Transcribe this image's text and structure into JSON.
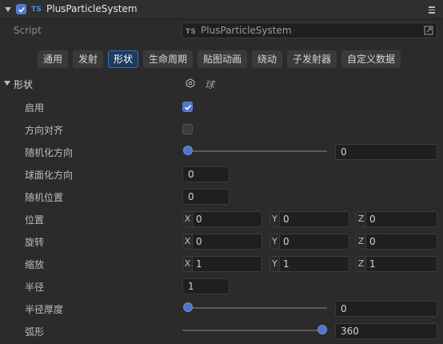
{
  "header": {
    "badge": "TS",
    "title": "PlusParticleSystem",
    "enabled": true,
    "menu_icon": "hamburger-menu-icon"
  },
  "script": {
    "label": "Script",
    "badge": "TS",
    "value": "PlusParticleSystem",
    "link_icon": "open-link-icon"
  },
  "tabs": [
    {
      "label": "通用",
      "active": false
    },
    {
      "label": "发射",
      "active": false
    },
    {
      "label": "形状",
      "active": true
    },
    {
      "label": "生命周期",
      "active": false
    },
    {
      "label": "贴图动画",
      "active": false
    },
    {
      "label": "绕动",
      "active": false
    },
    {
      "label": "子发射器",
      "active": false
    },
    {
      "label": "自定义数据",
      "active": false
    }
  ],
  "section": {
    "title": "形状",
    "shape_icon": "hexagon-settings-icon",
    "shape_value": "球"
  },
  "props": {
    "enable": {
      "label": "启用",
      "checked": true
    },
    "align_dir": {
      "label": "方向对齐",
      "checked": false
    },
    "random_dir": {
      "label": "随机化方向",
      "value": "0",
      "slider": 0
    },
    "spherize_dir": {
      "label": "球面化方向",
      "value": "0"
    },
    "random_pos": {
      "label": "随机位置",
      "value": "0"
    },
    "position": {
      "label": "位置",
      "x_label": "X",
      "x": "0",
      "y_label": "Y",
      "y": "0",
      "z_label": "Z",
      "z": "0"
    },
    "rotation": {
      "label": "旋转",
      "x_label": "X",
      "x": "0",
      "y_label": "Y",
      "y": "0",
      "z_label": "Z",
      "z": "0"
    },
    "scale": {
      "label": "缩放",
      "x_label": "X",
      "x": "1",
      "y_label": "Y",
      "y": "1",
      "z_label": "Z",
      "z": "1"
    },
    "radius": {
      "label": "半径",
      "value": "1"
    },
    "radius_thickness": {
      "label": "半径厚度",
      "value": "0",
      "slider": 0
    },
    "arc": {
      "label": "弧形",
      "value": "360",
      "slider": 1
    }
  },
  "colors": {
    "accent": "#4f76c8",
    "active_tab": "#1f3a5f",
    "background": "#2b2b2b"
  }
}
